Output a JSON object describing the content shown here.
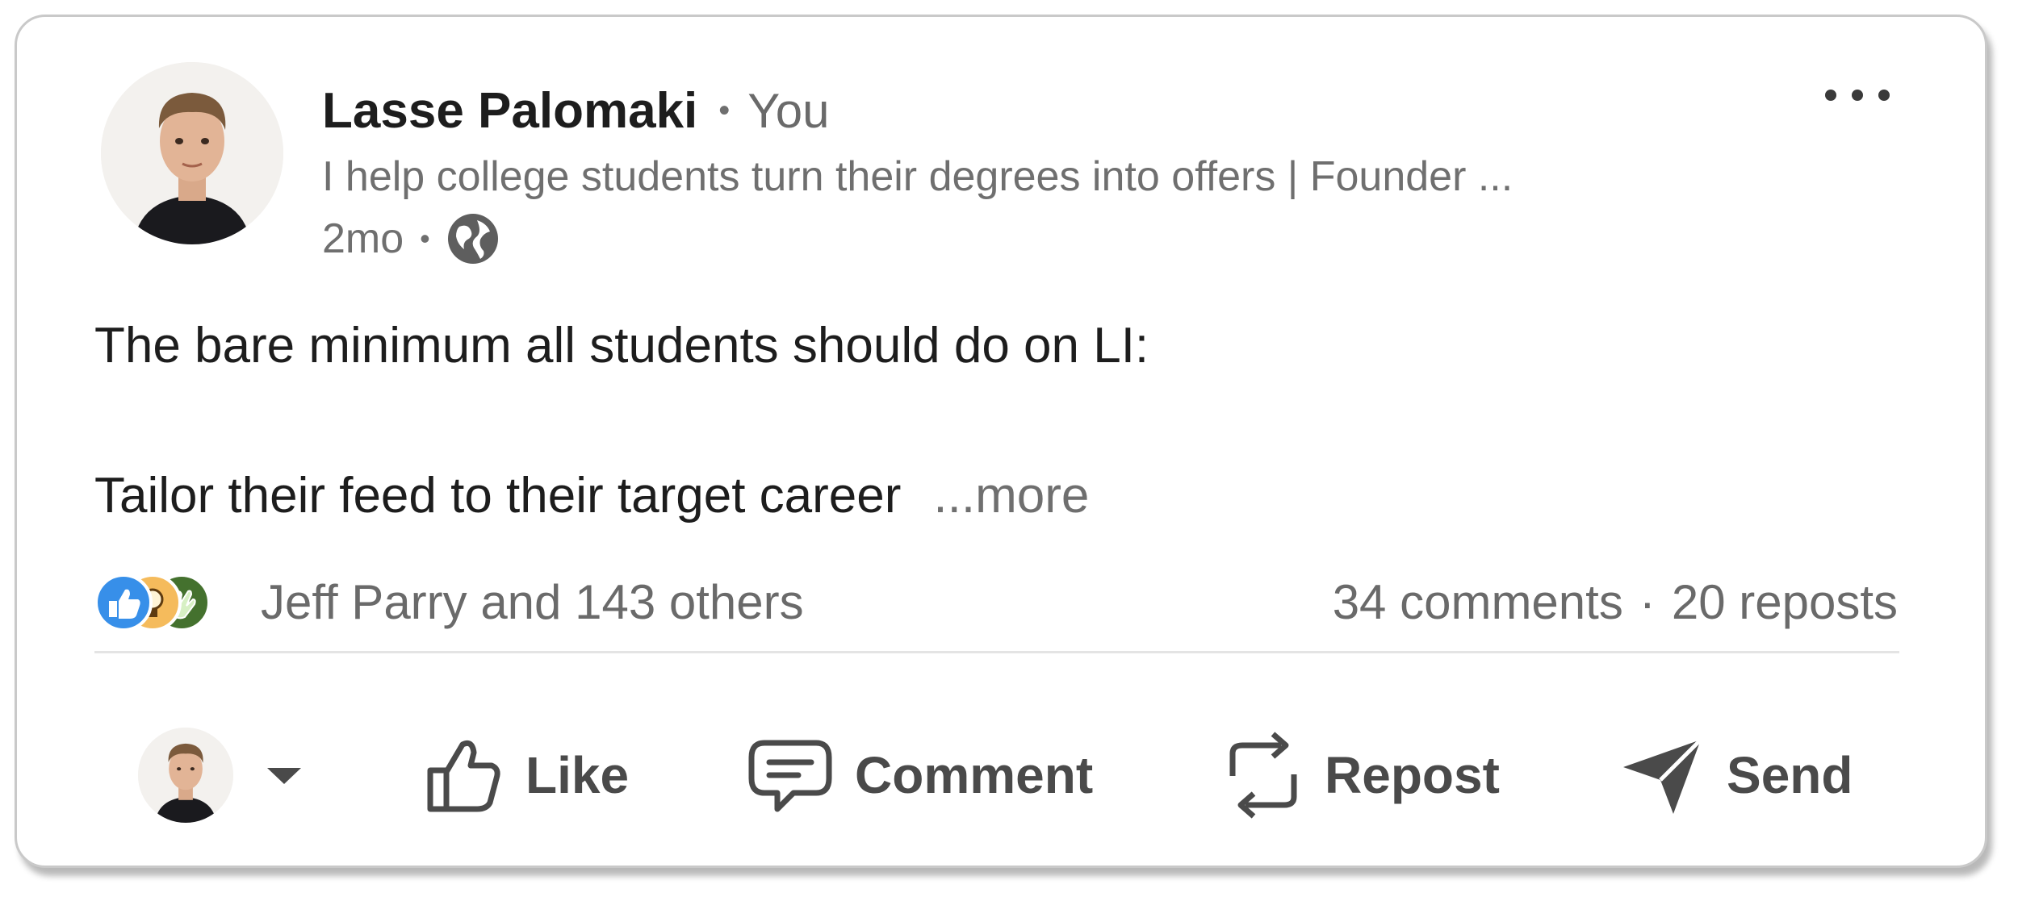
{
  "post": {
    "author_name": "Lasse Palomaki",
    "author_separator": "•",
    "author_relation": "You",
    "headline": "I help college students turn their degrees into offers | Founder ...",
    "time": "2mo",
    "time_separator": "•",
    "visibility_icon": "globe-icon",
    "body_line1": "The bare minimum all students should do on LI:",
    "body_line2": "Tailor their feed to their target career",
    "more_link": "...more"
  },
  "social": {
    "reactions": [
      "like-reaction-icon",
      "insightful-reaction-icon",
      "celebrate-reaction-icon"
    ],
    "reactors": "Jeff Parry and 143 others",
    "comments": "34 comments",
    "dot": "·",
    "reposts": "20 reposts"
  },
  "actions": {
    "like": "Like",
    "comment": "Comment",
    "repost": "Repost",
    "send": "Send"
  },
  "colors": {
    "like_blue": "#378fe9",
    "insightful_yellow": "#f5bb5c",
    "celebrate_green": "#44712e",
    "text_dark": "#1d1d1d",
    "text_muted": "#6f6f6f",
    "icon_gray": "#4a4a4a"
  }
}
